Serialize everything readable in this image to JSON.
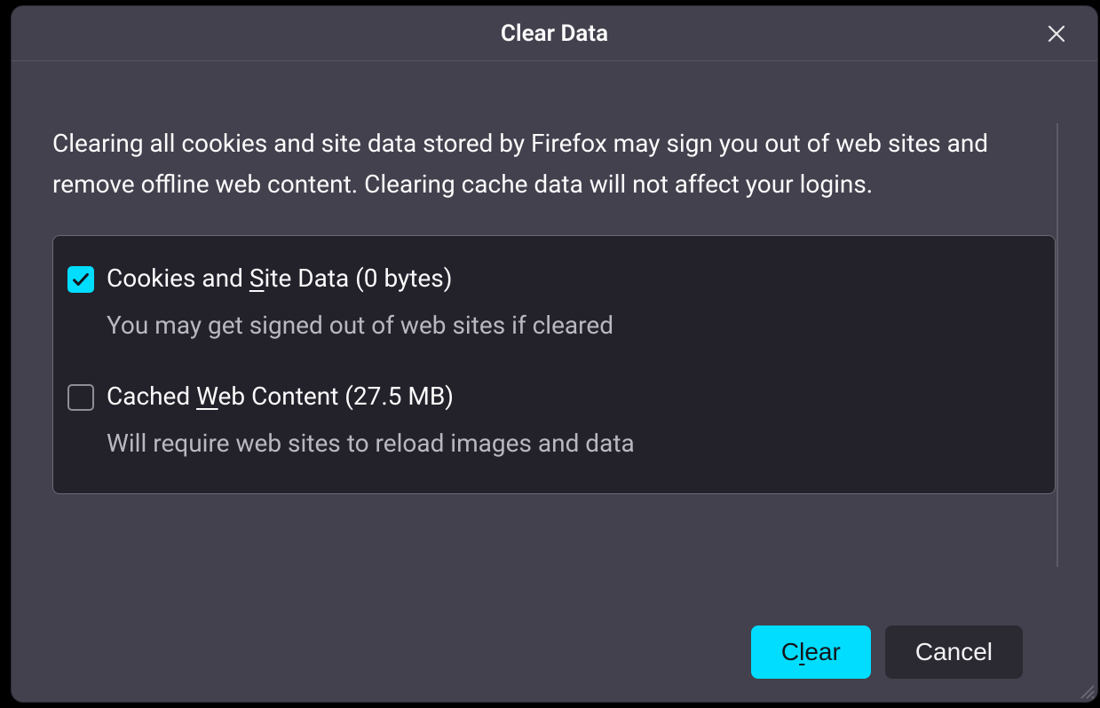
{
  "dialog": {
    "title": "Clear Data",
    "description": "Clearing all cookies and site data stored by Firefox may sign you out of web sites and remove offline web content. Clearing cache data will not affect your logins."
  },
  "options": {
    "cookies": {
      "checked": true,
      "label_pre": "Cookies and ",
      "label_ul": "S",
      "label_post": "ite Data (0 bytes)",
      "sub": "You may get signed out of web sites if cleared"
    },
    "cache": {
      "checked": false,
      "label_pre": "Cached ",
      "label_ul": "W",
      "label_post": "eb Content (27.5 MB)",
      "sub": "Will require web sites to reload images and data"
    }
  },
  "buttons": {
    "clear_pre": "C",
    "clear_ul": "l",
    "clear_post": "ear",
    "cancel": "Cancel"
  }
}
